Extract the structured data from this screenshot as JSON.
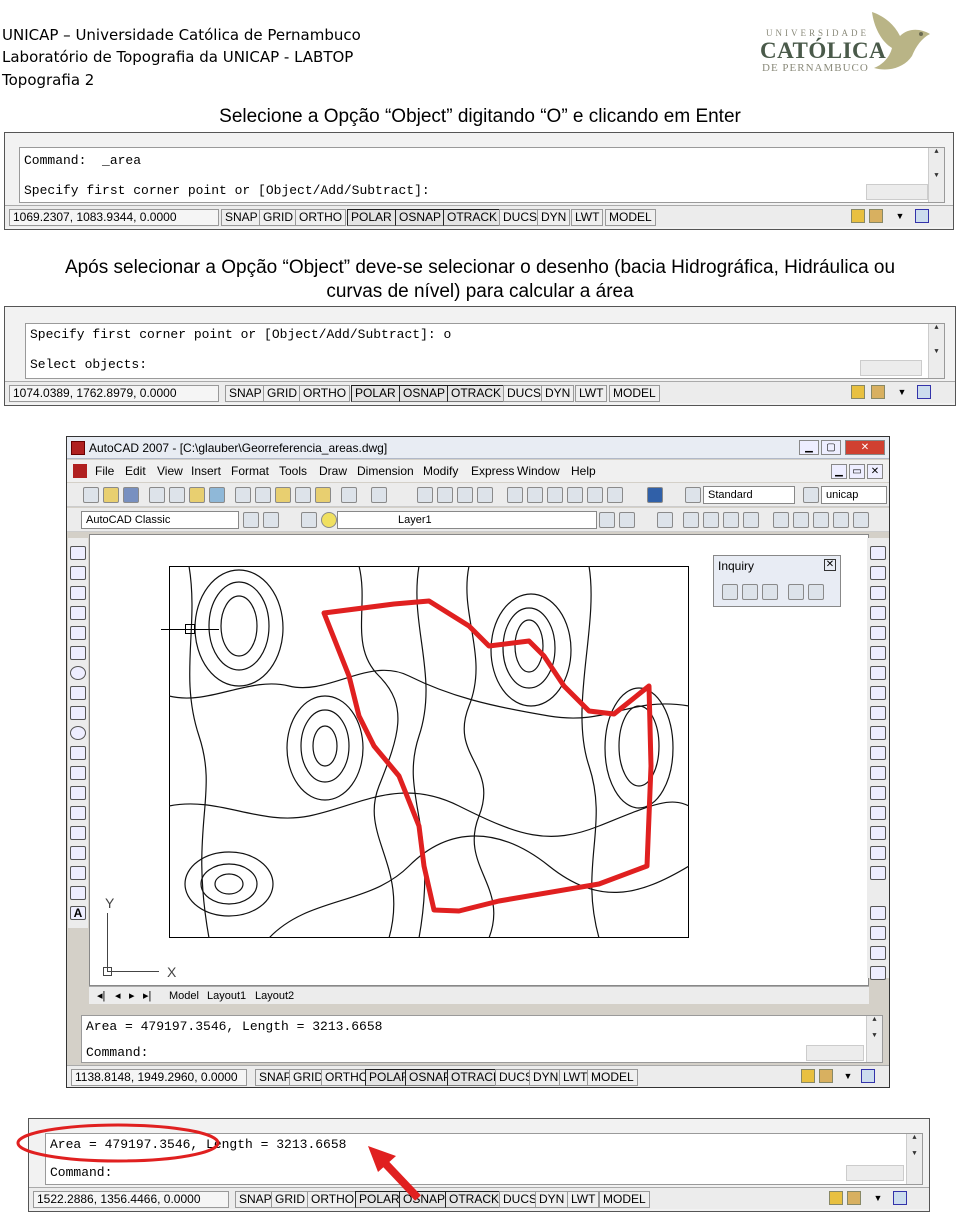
{
  "header": {
    "line1": "UNICAP – Universidade Católica de Pernambuco",
    "line2": "Laboratório de Topografia da UNICAP - LABTOP",
    "line3": "Topografia 2",
    "logo": {
      "top": "UNIVERSIDADE",
      "main": "CATÓLICA",
      "sub": "DE PERNAMBUCO"
    }
  },
  "captions": {
    "first": "Selecione a Opção “Object” digitando “O” e clicando em Enter",
    "second_line1": "Após selecionar a Opção “Object” deve-se selecionar o desenho (bacia Hidrográfica, Hidráulica ou",
    "second_line2": "curvas de nível) para calcular a área"
  },
  "status_buttons": [
    "SNAP",
    "GRID",
    "ORTHO",
    "POLAR",
    "OSNAP",
    "OTRACK",
    "DUCS",
    "DYN",
    "LWT",
    "MODEL"
  ],
  "panel1": {
    "line1": "Command:  _area",
    "line2": "Specify first corner point or [Object/Add/Subtract]:",
    "coords": "1069.2307, 1083.9344, 0.0000"
  },
  "panel2": {
    "line1": "Specify first corner point or [Object/Add/Subtract]: o",
    "line2": "Select objects:",
    "coords": "1074.0389, 1762.8979, 0.0000"
  },
  "autocad": {
    "title": "AutoCAD 2007 - [C:\\glauber\\Georreferencia_areas.dwg]",
    "menus": [
      "File",
      "Edit",
      "View",
      "Insert",
      "Format",
      "Tools",
      "Draw",
      "Dimension",
      "Modify",
      "Express",
      "Window",
      "Help"
    ],
    "text_style": "Standard",
    "dim_style": "unicap",
    "workspace": "AutoCAD Classic",
    "layer": "Layer1",
    "inquiry_title": "Inquiry",
    "ucs_y": "Y",
    "ucs_x": "X",
    "tabs": [
      "Model",
      "Layout1",
      "Layout2"
    ],
    "cmd_line1": "Area = 479197.3546, Length = 3213.6658",
    "cmd_line2": "Command:",
    "coords": "1138.8148, 1949.2960, 0.0000"
  },
  "panel3": {
    "line1": "Area = 479197.3546, Length = 3213.6658",
    "line2": "Command:",
    "coords": "1522.2886, 1356.4466, 0.0000"
  },
  "colors": {
    "highlight": "#e02020",
    "outline": "#e02020"
  }
}
